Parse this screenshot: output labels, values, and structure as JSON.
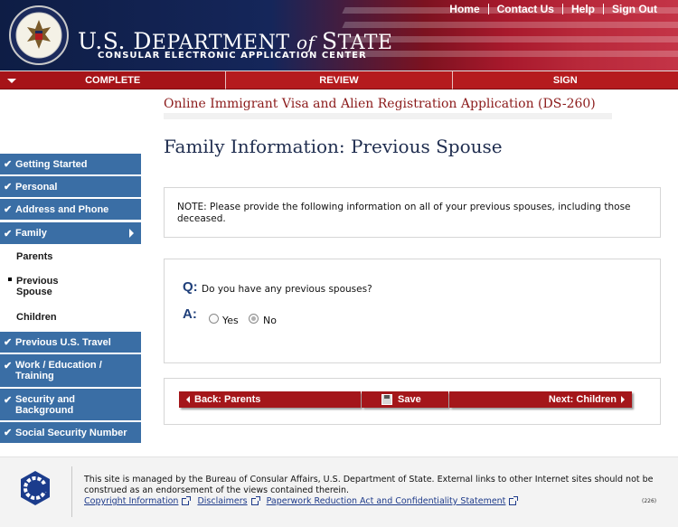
{
  "header": {
    "dept_us": "U.S. D",
    "dept_epartment": "EPARTMENT",
    "dept_of": "of",
    "dept_s": "S",
    "dept_tate": "TATE",
    "subtitle": "CONSULAR ELECTRONIC APPLICATION CENTER",
    "nav": [
      "Home",
      "Contact Us",
      "Help",
      "Sign Out"
    ]
  },
  "steps": [
    "COMPLETE",
    "REVIEW",
    "SIGN"
  ],
  "sidebar": {
    "items": [
      {
        "label": "Getting Started",
        "icon": "check-icon"
      },
      {
        "label": "Personal",
        "icon": "check-icon"
      },
      {
        "label": "Address and Phone",
        "icon": "check-icon"
      },
      {
        "label": "Family",
        "icon": "check-icon"
      },
      {
        "label": "Previous U.S. Travel",
        "icon": "check-icon"
      },
      {
        "label": "Work / Education / Training",
        "icon": "check-icon"
      },
      {
        "label": "Security and Background",
        "icon": "check-icon"
      },
      {
        "label": "Social Security Number",
        "icon": "check-icon"
      }
    ],
    "family_sub": [
      "Parents",
      "Previous Spouse",
      "Children"
    ],
    "check_glyph": "✔"
  },
  "main": {
    "form_title": "Online Immigrant Visa and Alien Registration Application (DS-260)",
    "page_title": "Family Information: Previous Spouse",
    "note": "NOTE: Please provide the following information on all of your previous spouses, including those deceased.",
    "q_label": "Q:",
    "question": "Do you have any previous spouses?",
    "a_label": "A:",
    "options": [
      {
        "label": "Yes",
        "selected": false
      },
      {
        "label": "No",
        "selected": true
      }
    ],
    "buttons": {
      "back": "Back: Parents",
      "save": "Save",
      "next": "Next: Children"
    }
  },
  "footer": {
    "text": "This site is managed by the Bureau of Consular Affairs, U.S. Department of State. External links to other Internet sites should not be construed as an endorsement of the views contained therein.",
    "links": [
      "Copyright Information",
      "Disclaimers",
      "Paperwork Reduction Act and Confidentiality Statement"
    ],
    "code": "(226)"
  },
  "colors": {
    "accent_red": "#a4161a",
    "sidebar_blue": "#3a6ea5",
    "title_navy": "#1f2d4f",
    "form_title_red": "#8b1a1a"
  }
}
